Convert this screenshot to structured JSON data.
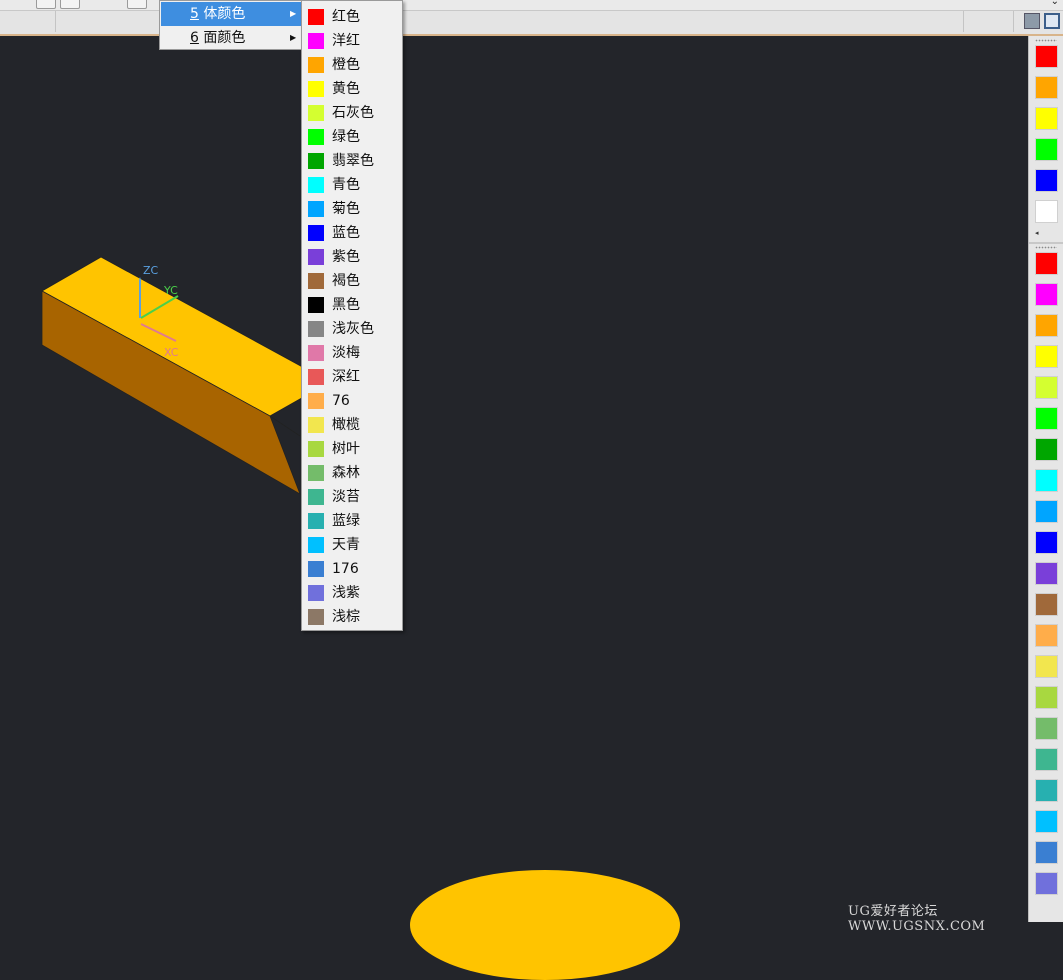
{
  "menu": {
    "items": [
      {
        "mnemonic": "5",
        "label": " 体颜色",
        "selected": true
      },
      {
        "mnemonic": "6",
        "label": " 面颜色",
        "selected": false
      }
    ]
  },
  "colors": [
    {
      "label": "红色",
      "hex": "#ff0000"
    },
    {
      "label": "洋红",
      "hex": "#ff00ff"
    },
    {
      "label": "橙色",
      "hex": "#ffa500"
    },
    {
      "label": "黄色",
      "hex": "#ffff00"
    },
    {
      "label": "石灰色",
      "hex": "#d4ff30"
    },
    {
      "label": "绿色",
      "hex": "#00ff00"
    },
    {
      "label": "翡翠色",
      "hex": "#00a600"
    },
    {
      "label": "青色",
      "hex": "#00ffff"
    },
    {
      "label": "菊色",
      "hex": "#00a5ff"
    },
    {
      "label": "蓝色",
      "hex": "#0000ff"
    },
    {
      "label": "紫色",
      "hex": "#7a3fd9"
    },
    {
      "label": "褐色",
      "hex": "#a0693a"
    },
    {
      "label": "黑色",
      "hex": "#000000"
    },
    {
      "label": "浅灰色",
      "hex": "#868686"
    },
    {
      "label": "淡梅",
      "hex": "#e078a8"
    },
    {
      "label": "深红",
      "hex": "#e85858"
    },
    {
      "label": "76",
      "hex": "#ffad4a"
    },
    {
      "label": "橄榄",
      "hex": "#f2e64e"
    },
    {
      "label": "树叶",
      "hex": "#a8d840"
    },
    {
      "label": "森林",
      "hex": "#74bc6a"
    },
    {
      "label": "淡苔",
      "hex": "#3eb690"
    },
    {
      "label": "蓝绿",
      "hex": "#27b0b0"
    },
    {
      "label": "天青",
      "hex": "#00c0ff"
    },
    {
      "label": "176",
      "hex": "#3a7fd2"
    },
    {
      "label": "浅紫",
      "hex": "#7070dc"
    },
    {
      "label": "浅棕",
      "hex": "#8c7866"
    }
  ],
  "palette_top": [
    "#ff0000",
    "#ffa500",
    "#ffff00",
    "#00ff00",
    "#0000ff",
    "#ffffff"
  ],
  "palette_bottom": [
    "#ff0000",
    "#ff00ff",
    "#ffa500",
    "#ffff00",
    "#d4ff30",
    "#00ff00",
    "#00a600",
    "#00ffff",
    "#00a5ff",
    "#0000ff",
    "#7a3fd9",
    "#a0693a",
    "#ffad4a",
    "#f2e64e",
    "#a8d840",
    "#74bc6a",
    "#3eb690",
    "#27b0b0",
    "#00c0ff",
    "#3a7fd2",
    "#7070dc"
  ],
  "triad": {
    "zc": "ZC",
    "yc": "YC",
    "xc": "XC"
  },
  "watermark": "UG爱好者论坛 WWW.UGSNX.COM",
  "solid_colors": {
    "top": "#ffc400",
    "front": "#a86400",
    "ellipse": "#ffc400"
  }
}
